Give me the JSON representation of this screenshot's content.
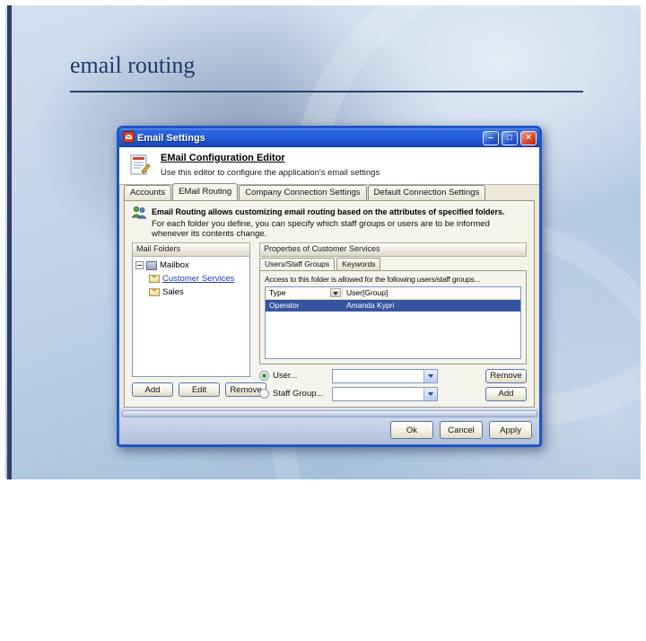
{
  "slide": {
    "title": "email routing"
  },
  "colors": {
    "titlebar_blue": "#2663e2",
    "selection_blue": "#35559f",
    "accent_navy": "#1c3a6b",
    "slide_background": "#bed1e6"
  },
  "window": {
    "title": "Email Settings",
    "controls": {
      "minimize": "–",
      "maximize": "□",
      "close": "×"
    }
  },
  "header": {
    "title": "EMail Configuration Editor",
    "subtitle": "Use this editor to configure the application's email settings"
  },
  "tabs": [
    {
      "label": "Accounts"
    },
    {
      "label": "EMail Routing"
    },
    {
      "label": "Company Connection Settings"
    },
    {
      "label": "Default Connection Settings"
    }
  ],
  "routing": {
    "intro_bold": "Email Routing allows customizing email routing based on the attributes of specified folders.",
    "intro_text": "For each folder you define, you can specify which staff groups or users are to be informed whenever its contents change.",
    "mail_folders": {
      "header": "Mail Folders",
      "root_label": "Mailbox",
      "items": [
        {
          "label": "Customer Services"
        },
        {
          "label": "Sales"
        }
      ],
      "buttons": {
        "add": "Add",
        "edit": "Edit",
        "remove": "Remove"
      }
    },
    "properties": {
      "header": "Properties of Customer Services",
      "tabs": [
        {
          "label": "Users/Staff Groups"
        },
        {
          "label": "Keywords"
        }
      ],
      "access_label": "Access to this folder is allowed for the following users/staff groups...",
      "list": {
        "columns": [
          {
            "label": "Type"
          },
          {
            "label": "User[Group]"
          }
        ],
        "rows": [
          {
            "type": "Operator",
            "user": "Amanda Kypri"
          }
        ]
      },
      "user_radio": "User...",
      "group_radio": "Staff Group...",
      "remove_button": "Remove",
      "add_button": "Add"
    }
  },
  "footer": {
    "ok": "Ok",
    "cancel": "Cancel",
    "apply": "Apply"
  }
}
